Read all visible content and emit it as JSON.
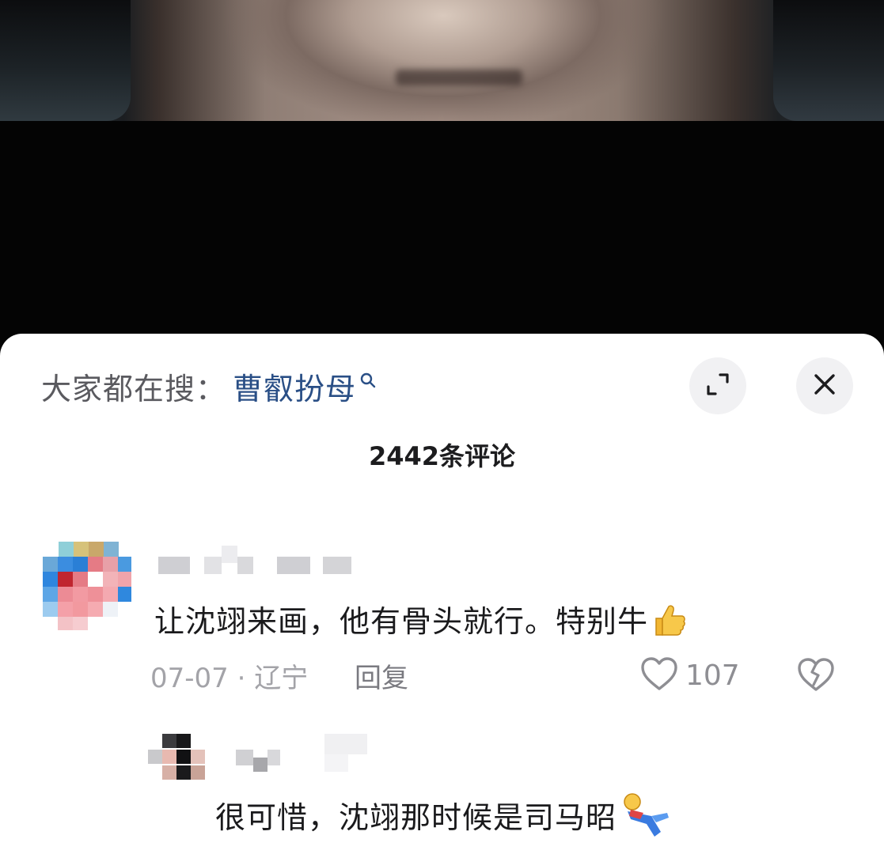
{
  "trending": {
    "label": "大家都在搜：",
    "keyword": "曹叡扮母"
  },
  "comments_header": {
    "count_text": "2442条评论"
  },
  "comments": [
    {
      "text": "让沈翊来画，他有骨头就行。特别牛",
      "date": "07-07",
      "separator": "·",
      "location": "辽宁",
      "reply_label": "回复",
      "likes": "107"
    },
    {
      "text": "很可惜，沈翊那时候是司马昭"
    }
  ],
  "icons": {
    "expand": "expand-icon",
    "close": "close-icon",
    "search": "search-icon",
    "like": "heart-outline-icon",
    "dislike": "broken-heart-icon"
  },
  "colors": {
    "keyword": "#2a4f86",
    "label": "#5a5a5f",
    "meta": "#a3a3a8"
  }
}
